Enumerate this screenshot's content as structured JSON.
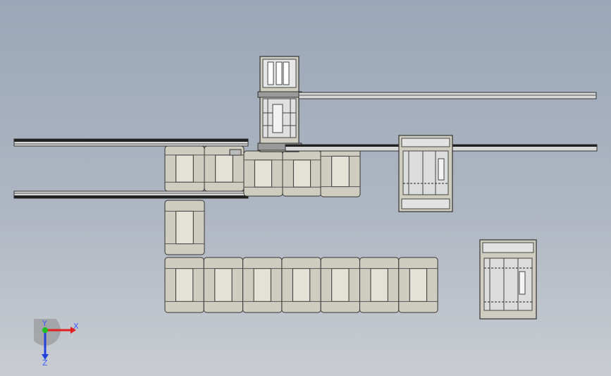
{
  "view": {
    "background_top": "#9aa7b8",
    "background_bottom": "#c9cdd2",
    "part_fill": "#cfcdbf",
    "edge_color": "#3a3a3a"
  },
  "triad": {
    "x_label": "X",
    "y_label": "Y",
    "z_label": "Z",
    "x_color": "#e02020",
    "y_color": "#20c020",
    "z_color": "#2040e0"
  }
}
